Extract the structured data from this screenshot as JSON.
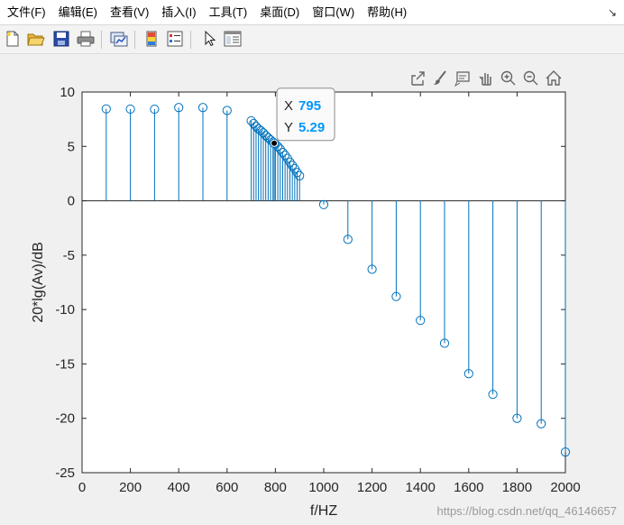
{
  "menubar": {
    "items": [
      "文件(F)",
      "编辑(E)",
      "查看(V)",
      "插入(I)",
      "工具(T)",
      "桌面(D)",
      "窗口(W)",
      "帮助(H)"
    ],
    "corner_glyph": "↘"
  },
  "toolbar": {
    "icons": [
      "new-figure-icon",
      "open-file-icon",
      "save-icon",
      "print-icon",
      "link-plot-icon",
      "insert-colorbar-icon",
      "insert-legend-icon",
      "edit-plot-cursor-icon",
      "property-inspector-icon"
    ]
  },
  "axes_toolbar": {
    "icons": [
      "export-icon",
      "brush-icon",
      "data-tips-icon",
      "pan-hand-icon",
      "zoom-in-icon",
      "zoom-out-icon",
      "restore-view-home-icon"
    ]
  },
  "chart_data": {
    "type": "stem",
    "title": "",
    "xlabel": "f/HZ",
    "ylabel": "20*lg(Av)/dB",
    "xlim": [
      0,
      2000
    ],
    "ylim": [
      -25,
      10
    ],
    "xticks": [
      0,
      200,
      400,
      600,
      800,
      1000,
      1200,
      1400,
      1600,
      1800,
      2000
    ],
    "yticks": [
      10,
      5,
      0,
      -5,
      -10,
      -15,
      -20,
      -25
    ],
    "color": "#0072bd",
    "baseline": 0,
    "x": [
      100,
      200,
      300,
      400,
      500,
      600,
      700,
      710,
      720,
      730,
      740,
      750,
      760,
      770,
      780,
      790,
      795,
      800,
      810,
      820,
      830,
      840,
      850,
      860,
      870,
      880,
      890,
      900,
      1000,
      1100,
      1200,
      1300,
      1400,
      1500,
      1600,
      1700,
      1800,
      1900,
      2000
    ],
    "y": [
      8.45,
      8.43,
      8.42,
      8.57,
      8.57,
      8.3,
      7.35,
      7.1,
      6.85,
      6.6,
      6.45,
      6.25,
      6.0,
      5.8,
      5.6,
      5.4,
      5.29,
      5.2,
      5.0,
      4.75,
      4.45,
      4.2,
      3.9,
      3.55,
      3.25,
      2.95,
      2.6,
      2.3,
      -0.35,
      -3.55,
      -6.3,
      -8.8,
      -11.0,
      -13.1,
      -15.9,
      -17.8,
      -20.0,
      -20.5,
      -23.1
    ],
    "datatip": {
      "x_label": "X",
      "y_label": "Y",
      "x_value": "795",
      "y_value": "5.29",
      "point_index": 16
    }
  },
  "watermark": "https://blog.csdn.net/qq_46146657"
}
